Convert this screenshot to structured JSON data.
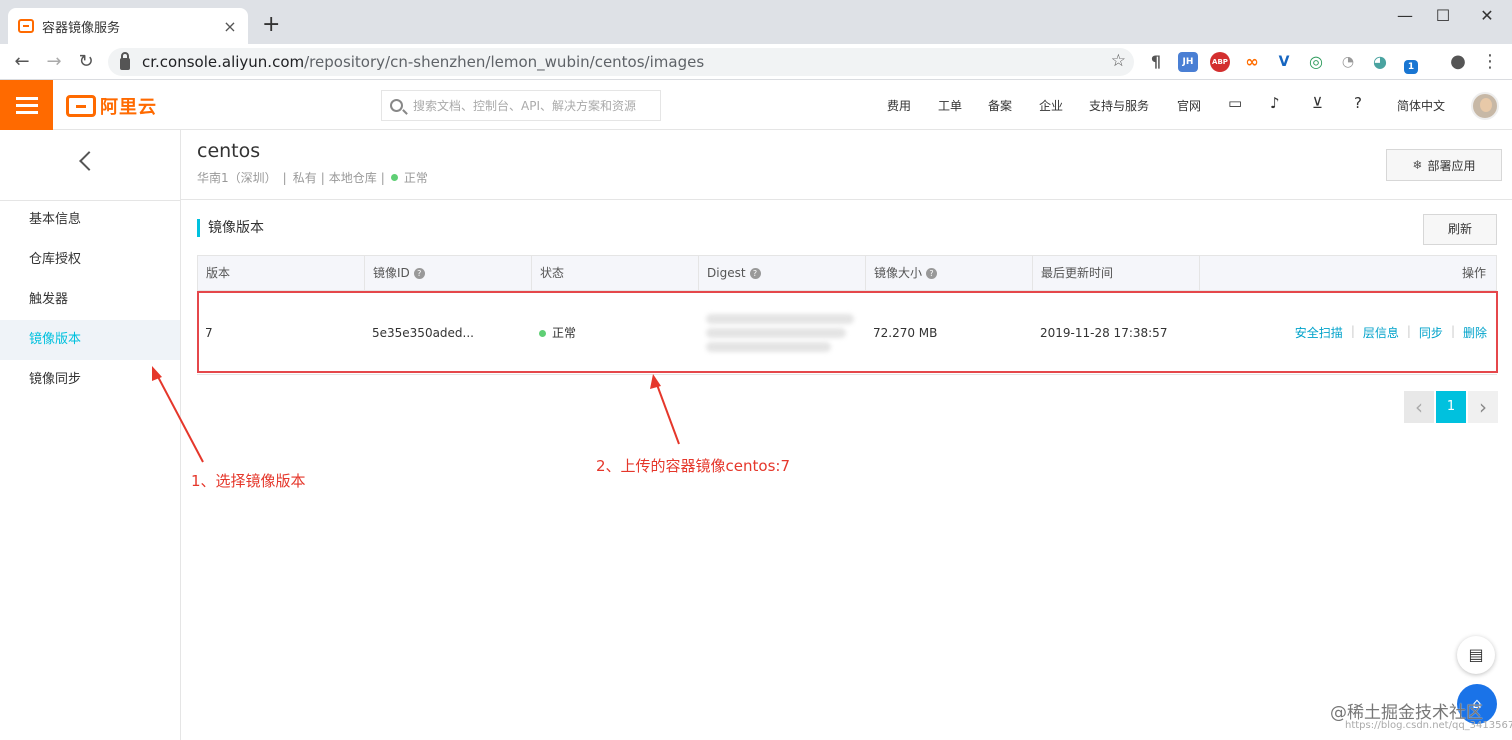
{
  "browser": {
    "tab_title": "容器镜像服务",
    "tab_close": "×",
    "new_tab": "+",
    "url_host": "cr.console.aliyun.com",
    "url_path": "/repository/cn-shenzhen/lemon_wubin/centos/images",
    "extensions": [
      {
        "name": "pilcrow",
        "label": "¶",
        "color": "#555555"
      },
      {
        "name": "jsonhandle",
        "label": "JH",
        "color": "#4a7fd4"
      },
      {
        "name": "adblock",
        "label": "ABP",
        "color": "#d32f2f"
      },
      {
        "name": "infinity",
        "label": "∞",
        "color": "#ff6d00"
      },
      {
        "name": "vue-devtools",
        "label": "V",
        "color": "#1565c0"
      },
      {
        "name": "globe",
        "label": "◎",
        "color": "#2e9b5c"
      },
      {
        "name": "speed",
        "label": "◔",
        "color": "#999999"
      },
      {
        "name": "ghost",
        "label": "◕",
        "color": "#4aa3a0"
      },
      {
        "name": "badge-one",
        "label": "1",
        "color": "#1976d2"
      }
    ]
  },
  "topbar": {
    "logo_text": "阿里云",
    "search_placeholder": "搜索文档、控制台、API、解决方案和资源",
    "nav": [
      "费用",
      "工单",
      "备案",
      "企业",
      "支持与服务",
      "官网"
    ],
    "language": "简体中文",
    "colors": {
      "brand": "#ff6a00",
      "accent": "#00c1de"
    }
  },
  "sidebar": {
    "items": [
      {
        "label": "基本信息",
        "active": false
      },
      {
        "label": "仓库授权",
        "active": false
      },
      {
        "label": "触发器",
        "active": false
      },
      {
        "label": "镜像版本",
        "active": true
      },
      {
        "label": "镜像同步",
        "active": false
      }
    ]
  },
  "repo": {
    "name": "centos",
    "region": "华南1（深圳）",
    "visibility": "私有",
    "type": "本地仓库",
    "status": "正常",
    "deploy_label": "部署应用"
  },
  "images": {
    "section_title": "镜像版本",
    "refresh_label": "刷新",
    "columns": [
      "版本",
      "镜像ID",
      "状态",
      "Digest",
      "镜像大小",
      "最后更新时间",
      "操作"
    ],
    "rows": [
      {
        "version": "7",
        "image_id": "5e35e350aded...",
        "status": "正常",
        "size": "72.270 MB",
        "updated": "2019-11-28 17:38:57"
      }
    ],
    "actions": [
      "安全扫描",
      "层信息",
      "同步",
      "删除"
    ]
  },
  "pager": {
    "prev": "‹",
    "current": "1",
    "next": "›"
  },
  "annotations": {
    "step1": "1、选择镜像版本",
    "step2": "2、上传的容器镜像centos:7"
  },
  "watermark": {
    "main": "@稀土掘金技术社区",
    "sub": "https://blog.csdn.net/qq_3413567"
  }
}
